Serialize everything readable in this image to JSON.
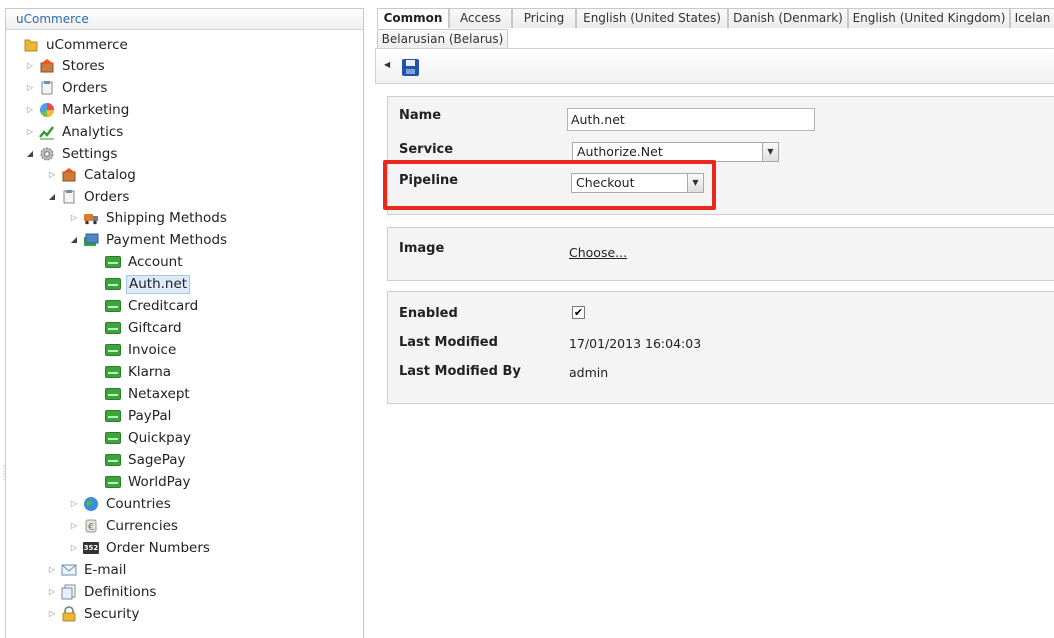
{
  "tree": {
    "header": "uCommerce",
    "items": [
      {
        "label": "uCommerce",
        "icon": "folder-icon"
      },
      {
        "label": "Stores",
        "icon": "store-icon"
      },
      {
        "label": "Orders",
        "icon": "orders-icon"
      },
      {
        "label": "Marketing",
        "icon": "marketing-icon"
      },
      {
        "label": "Analytics",
        "icon": "analytics-icon"
      },
      {
        "label": "Settings",
        "icon": "gear-icon"
      },
      {
        "label": "Catalog",
        "icon": "catalog-icon"
      },
      {
        "label": "Orders",
        "icon": "orders-icon"
      },
      {
        "label": "Shipping Methods",
        "icon": "truck-icon"
      },
      {
        "label": "Payment Methods",
        "icon": "payment-methods-icon"
      },
      {
        "label": "Account",
        "icon": "payment-method-icon"
      },
      {
        "label": "Auth.net",
        "icon": "payment-method-icon"
      },
      {
        "label": "Creditcard",
        "icon": "payment-method-icon"
      },
      {
        "label": "Giftcard",
        "icon": "payment-method-icon"
      },
      {
        "label": "Invoice",
        "icon": "payment-method-icon"
      },
      {
        "label": "Klarna",
        "icon": "payment-method-icon"
      },
      {
        "label": "Netaxept",
        "icon": "payment-method-icon"
      },
      {
        "label": "PayPal",
        "icon": "payment-method-icon"
      },
      {
        "label": "Quickpay",
        "icon": "payment-method-icon"
      },
      {
        "label": "SagePay",
        "icon": "payment-method-icon"
      },
      {
        "label": "WorldPay",
        "icon": "payment-method-icon"
      },
      {
        "label": "Countries",
        "icon": "globe-icon"
      },
      {
        "label": "Currencies",
        "icon": "currency-icon"
      },
      {
        "label": "Order Numbers",
        "icon": "order-numbers-icon"
      },
      {
        "label": "E-mail",
        "icon": "email-icon"
      },
      {
        "label": "Definitions",
        "icon": "definitions-icon"
      },
      {
        "label": "Security",
        "icon": "lock-icon"
      }
    ],
    "order_numbers_icon_text": "352"
  },
  "tabs": [
    {
      "label": "Common",
      "active": true
    },
    {
      "label": "Access"
    },
    {
      "label": "Pricing"
    },
    {
      "label": "English (United States)"
    },
    {
      "label": "Danish (Denmark)"
    },
    {
      "label": "English (United Kingdom)"
    },
    {
      "label": "Icelan"
    },
    {
      "label": "Belarusian (Belarus)"
    }
  ],
  "toolbar": {
    "back_icon": "back-arrow-icon",
    "save_icon": "save-icon"
  },
  "form": {
    "name_label": "Name",
    "name_value": "Auth.net",
    "service_label": "Service",
    "service_value": "Authorize.Net",
    "pipeline_label": "Pipeline",
    "pipeline_value": "Checkout",
    "image_label": "Image",
    "image_link": "Choose...",
    "enabled_label": "Enabled",
    "enabled_checked": true,
    "enabled_mark": "✔",
    "last_modified_label": "Last Modified",
    "last_modified_value": "17/01/2013 16:04:03",
    "last_modified_by_label": "Last Modified By",
    "last_modified_by_value": "admin"
  },
  "colors": {
    "highlight": "#e8291c",
    "header_link": "#2a6cae",
    "selected_bg": "#dceafb"
  }
}
